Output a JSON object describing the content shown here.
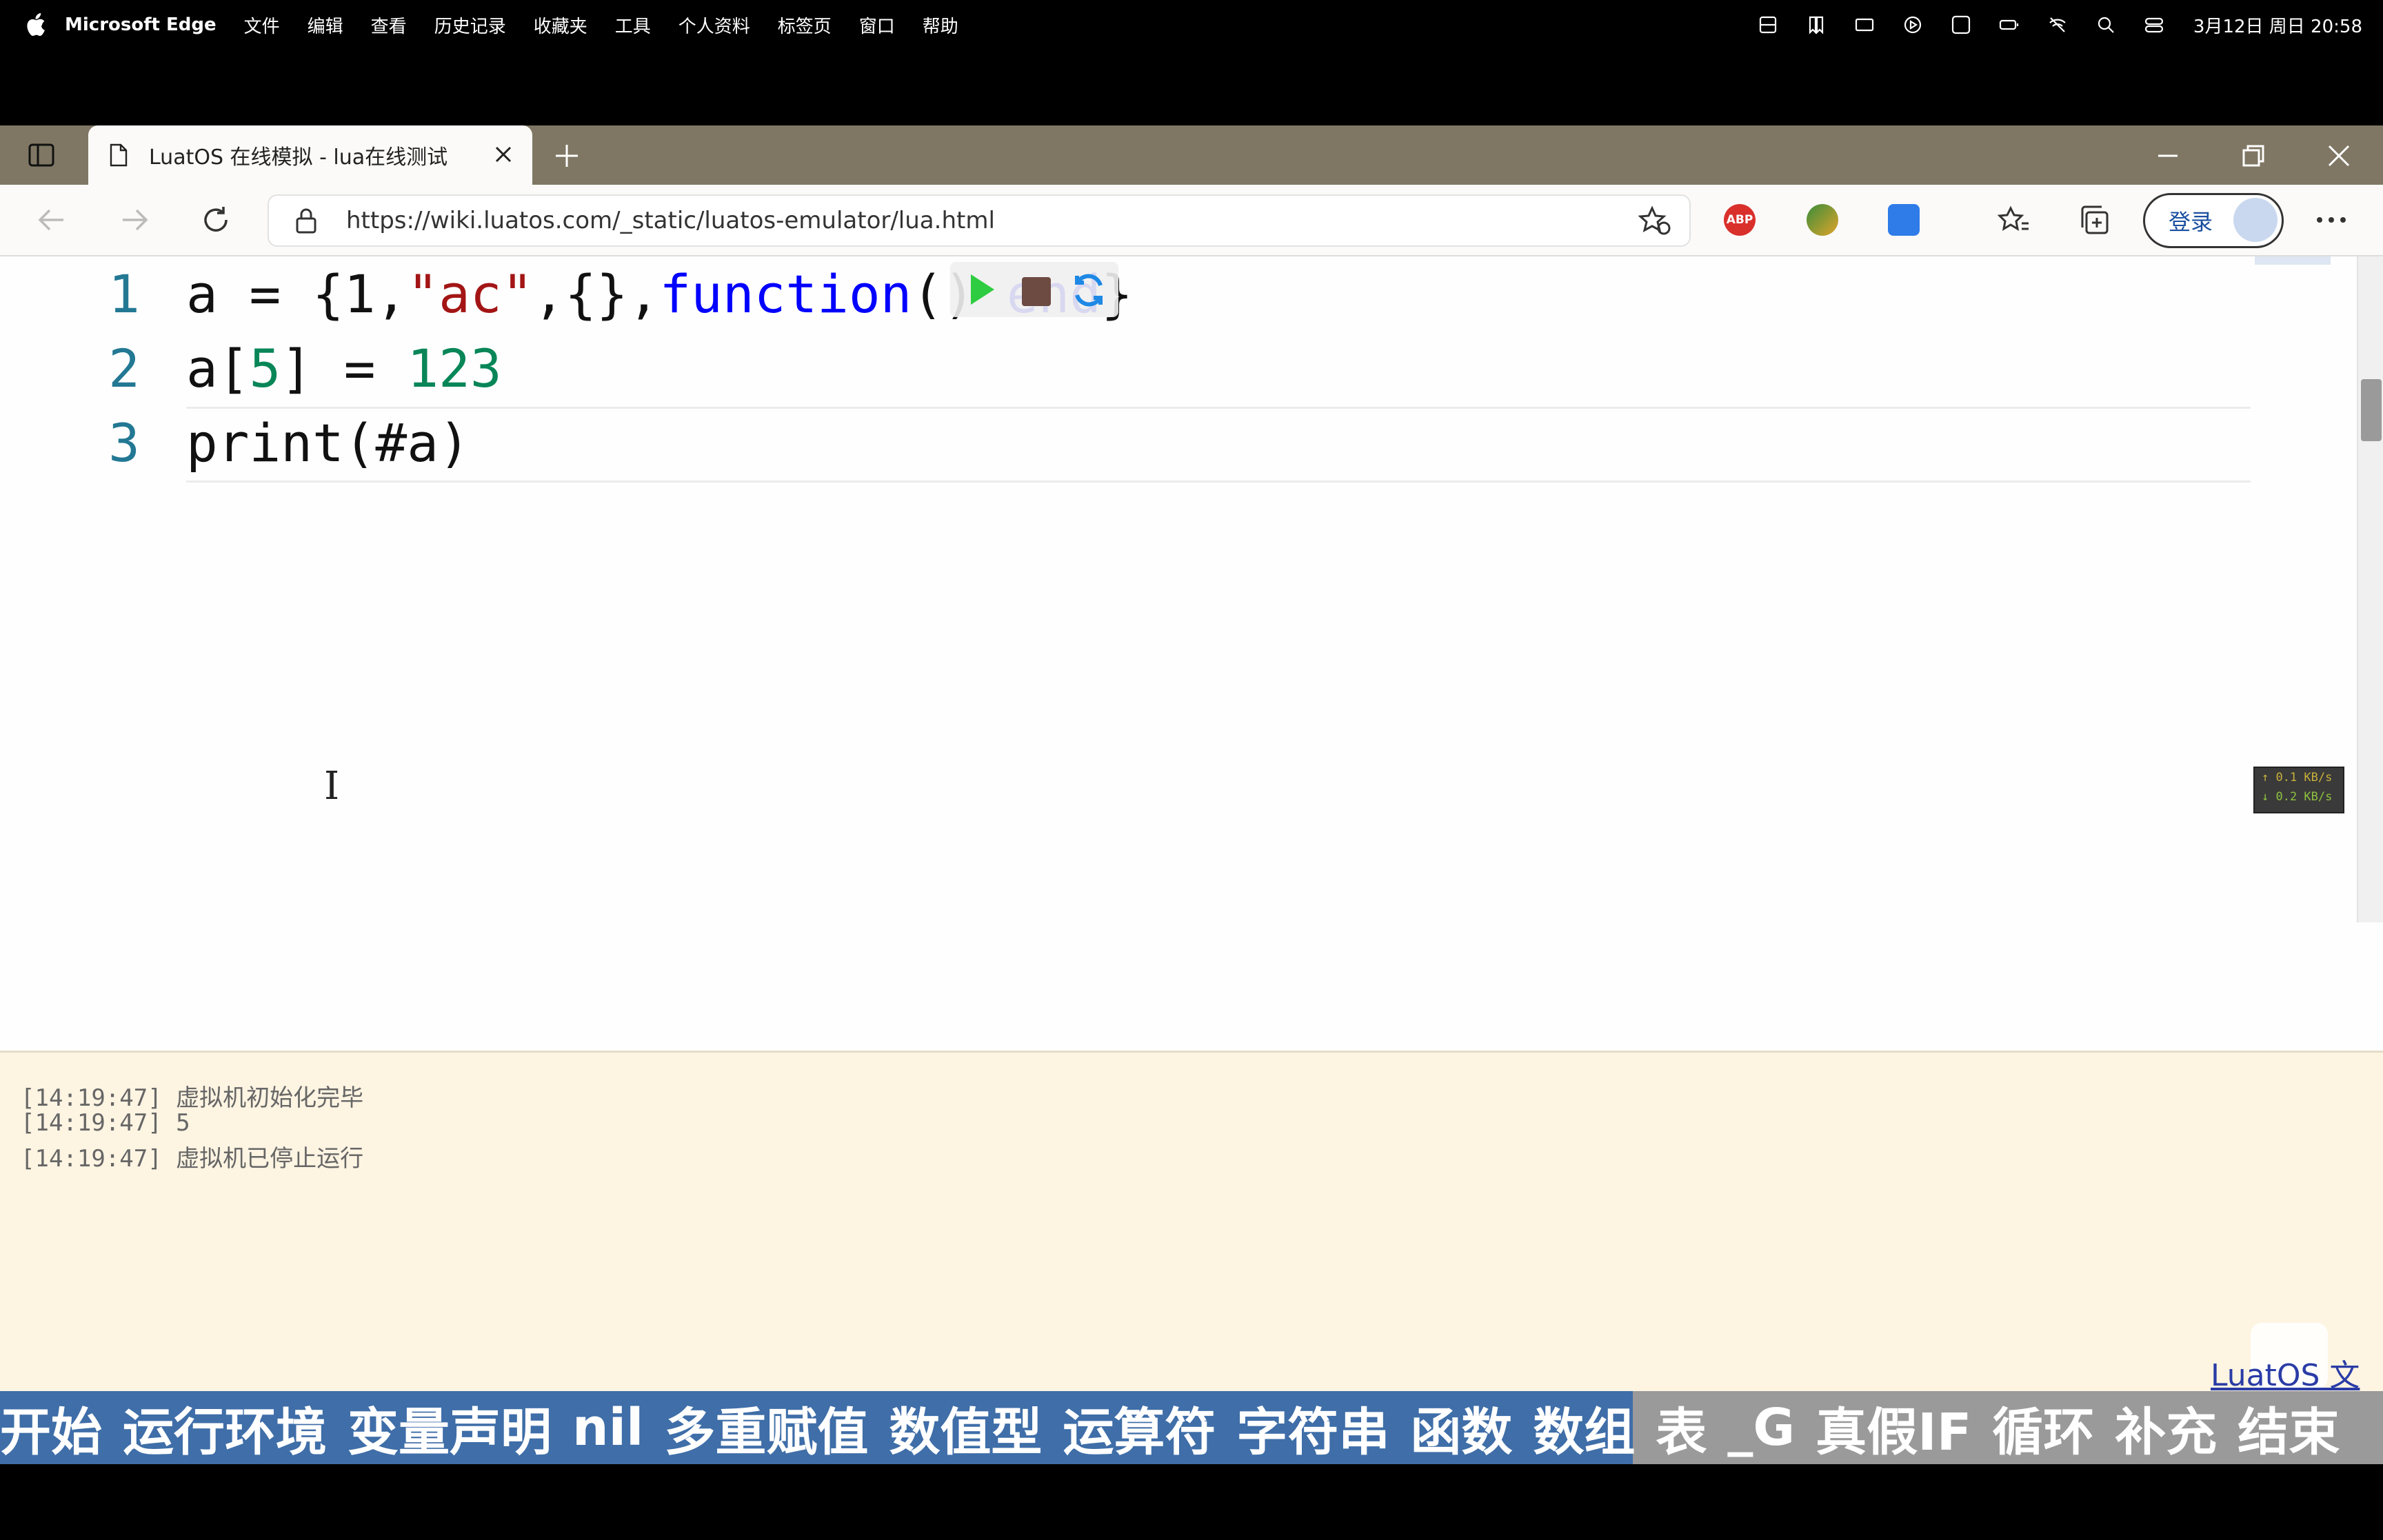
{
  "menubar": {
    "app": "Microsoft Edge",
    "items": [
      "文件",
      "编辑",
      "查看",
      "历史记录",
      "收藏夹",
      "工具",
      "个人资料",
      "标签页",
      "窗口",
      "帮助"
    ],
    "clock": "3月12日 周日 20:58"
  },
  "browser": {
    "tab_title": "LuatOS 在线模拟 - lua在线测试",
    "url": "https://wiki.luatos.com/_static/luatos-emulator/lua.html",
    "login_label": "登录",
    "ext_abp": "ABP"
  },
  "editor": {
    "lines": [
      {
        "num": "1",
        "p1": "a",
        "p2": " = ",
        "p3": "{1,",
        "p4": "\"ac\"",
        "p5": ",{},",
        "p6": "function",
        "p7": "() ",
        "p8": "end",
        "p9": "}"
      },
      {
        "num": "2",
        "p1": "a[",
        "p2": "5",
        "p3": "] = ",
        "p4": "123"
      },
      {
        "num": "3",
        "p1": "print(#a)"
      }
    ],
    "netspeed_up": "↑ 0.1 KB/s",
    "netspeed_down": "↓ 0.2 KB/s"
  },
  "console": {
    "logs": [
      "[14:19:47] 虚拟机初始化完毕",
      "[14:19:47] 5",
      "[14:19:47] 虚拟机已停止运行"
    ],
    "doc_link": "LuatOS 文档"
  },
  "chapters": [
    "开始",
    "运行环境",
    "变量声明",
    "nil",
    "多重赋值",
    "数值型",
    "运算符",
    "字符串",
    "函数",
    "数组",
    "表",
    "_G",
    "真假IF",
    "循环",
    "补充",
    "结束"
  ],
  "colors": {
    "keyword": "#0000ff",
    "string": "#a31515",
    "number": "#098658",
    "line_number": "#237893",
    "chapter_active": "#3f6ea8",
    "chapter_inactive": "#9a9a9a"
  }
}
